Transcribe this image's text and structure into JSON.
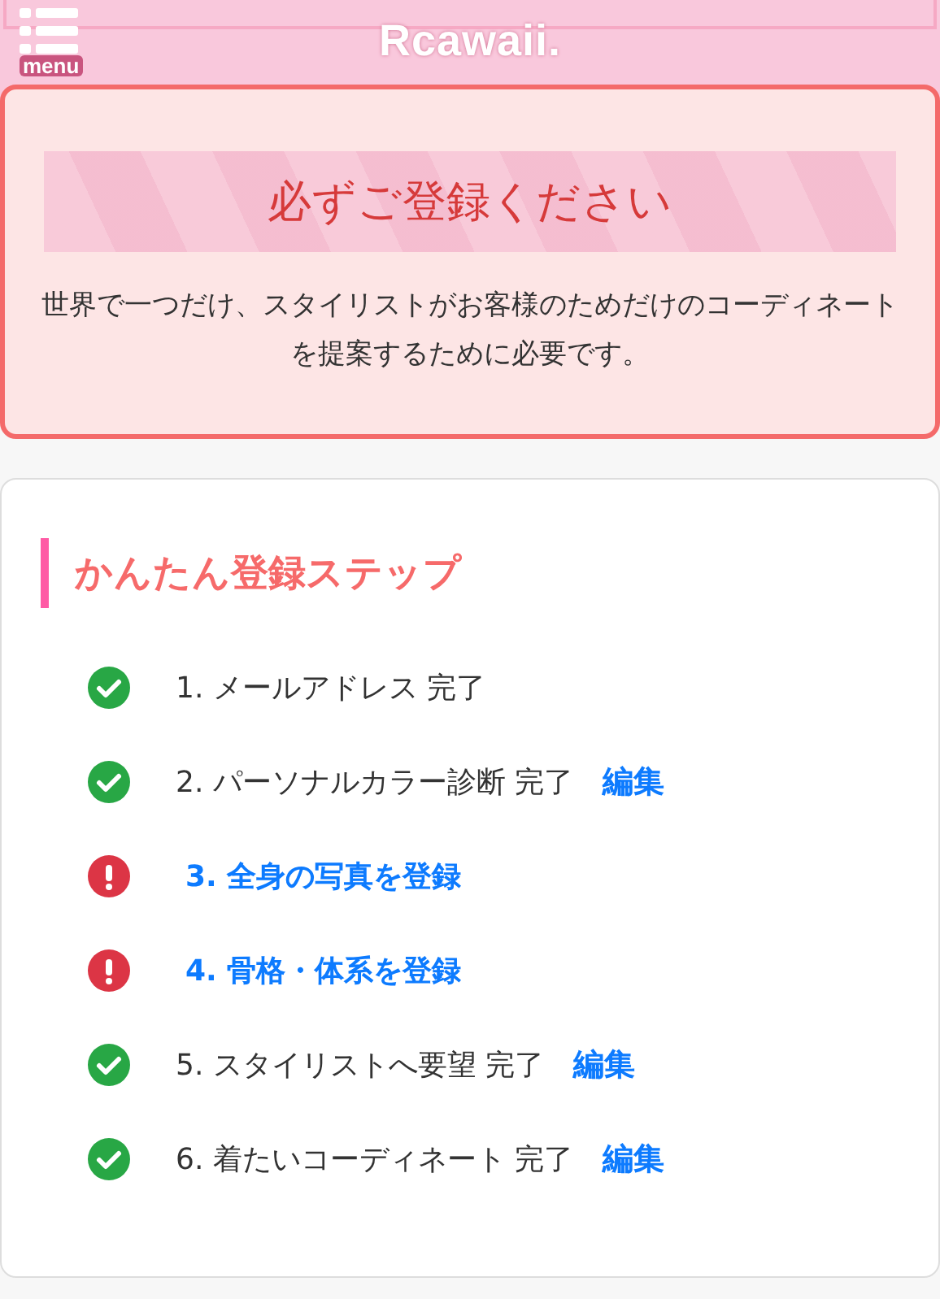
{
  "header": {
    "menu_label": "menu",
    "logo": "Rcawaii."
  },
  "notice": {
    "title": "必ずご登録ください",
    "text": "世界で一つだけ、スタイリストがお客様のためだけのコーディネートを提案するために必要です。"
  },
  "steps": {
    "heading": "かんたん登録ステップ",
    "items": [
      {
        "kind": "done",
        "label": "1. メールアドレス 完了"
      },
      {
        "kind": "done",
        "label": "2. パーソナルカラー診断 完了",
        "edit": "編集"
      },
      {
        "kind": "todo",
        "label": "3. 全身の写真を登録"
      },
      {
        "kind": "todo",
        "label": "4. 骨格・体系を登録"
      },
      {
        "kind": "done",
        "label": "5. スタイリストへ要望 完了",
        "edit": "編集"
      },
      {
        "kind": "done",
        "label": "6. 着たいコーディネート 完了",
        "edit": "編集"
      }
    ]
  }
}
